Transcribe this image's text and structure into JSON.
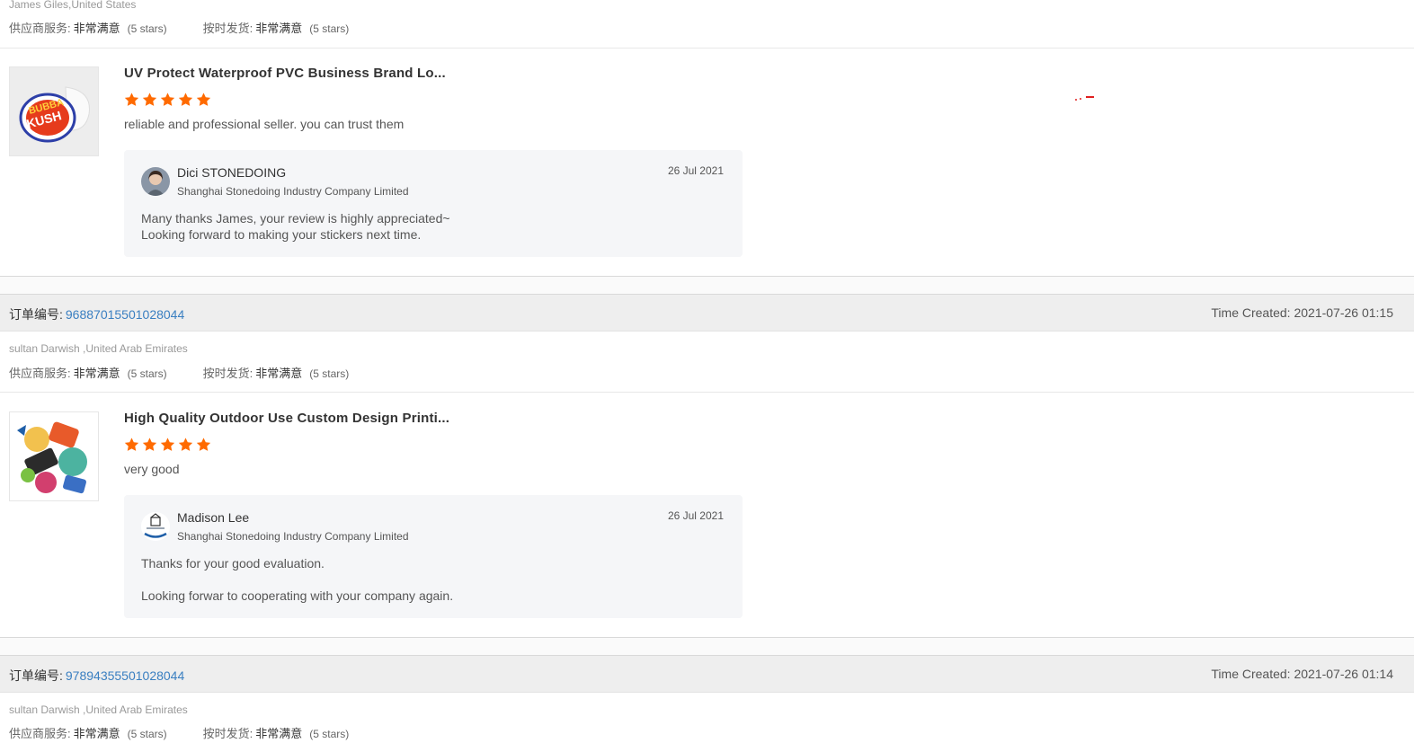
{
  "review1": {
    "buyer": "James Giles,United States",
    "supplier_service": {
      "label": "供应商服务:",
      "value": "非常满意",
      "stars": "(5 stars)"
    },
    "on_time": {
      "label": "按时发货:",
      "value": "非常满意",
      "stars": "(5 stars)"
    },
    "product_title": "UV Protect Waterproof PVC Business Brand Lo...",
    "rating": 5,
    "text": "reliable and professional seller. you can trust them",
    "reply": {
      "name": "Dici STONEDOING",
      "company": "Shanghai Stonedoing Industry Company Limited",
      "date": "26 Jul 2021",
      "lines": [
        "Many thanks James, your review is highly appreciated~",
        "Looking forward to making your stickers next time."
      ]
    }
  },
  "order2": {
    "label": "订单编号:",
    "number": "96887015501028044",
    "time_created": "Time Created: 2021-07-26 01:15",
    "buyer": "sultan Darwish ,United Arab Emirates",
    "supplier_service": {
      "label": "供应商服务:",
      "value": "非常满意",
      "stars": "(5 stars)"
    },
    "on_time": {
      "label": "按时发货:",
      "value": "非常满意",
      "stars": "(5 stars)"
    },
    "product_title": "High Quality Outdoor Use Custom Design Printi...",
    "rating": 5,
    "text": "very good",
    "reply": {
      "name": "Madison Lee",
      "company": "Shanghai Stonedoing Industry Company Limited",
      "date": "26 Jul 2021",
      "lines": [
        "Thanks for your good evaluation.",
        "Looking forwar to cooperating with your company again."
      ]
    }
  },
  "order3": {
    "label": "订单编号:",
    "number": "97894355501028044",
    "time_created": "Time Created: 2021-07-26 01:14",
    "buyer": "sultan Darwish ,United Arab Emirates",
    "supplier_service": {
      "label": "供应商服务:",
      "value": "非常满意",
      "stars": "(5 stars)"
    },
    "on_time": {
      "label": "按时发货:",
      "value": "非常满意",
      "stars": "(5 stars)"
    }
  },
  "colors": {
    "accent_link": "#3a7fc1",
    "star": "#ff6a00",
    "reply_bg": "#f5f6f8",
    "order_bar_bg": "#eeeeee"
  },
  "icons": [
    "star-icon",
    "reviewer-avatar",
    "company-logo-avatar",
    "product-thumbnail"
  ]
}
